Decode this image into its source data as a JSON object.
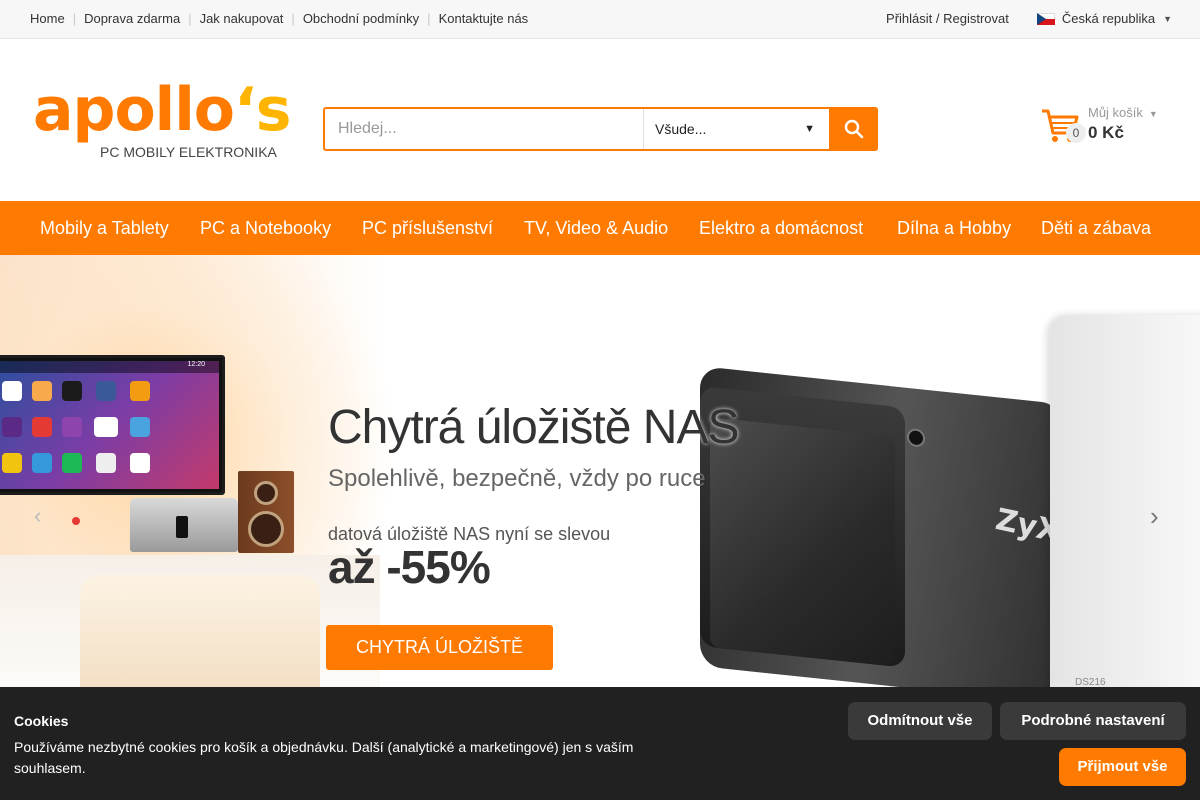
{
  "topbar": {
    "links": [
      "Home",
      "Doprava zdarma",
      "Jak nakupovat",
      "Obchodní podmínky",
      "Kontaktujte nás"
    ],
    "login": "Přihlásit / Registrovat",
    "country": "Česká republika"
  },
  "logo": {
    "main": "apollo",
    "apostrophe": "‘s",
    "sub": "PC MOBILY ELEKTRONIKA"
  },
  "search": {
    "placeholder": "Hledej...",
    "scope": "Všude..."
  },
  "cart": {
    "title": "Můj košík",
    "count": "0",
    "total": "0 Kč"
  },
  "nav": [
    "Mobily a Tablety",
    "PC a Notebooky",
    "PC příslušenství",
    "TV, Video & Audio",
    "Elektro a domácnost",
    "Dílna a Hobby",
    "Děti a zábava"
  ],
  "hero": {
    "title": "Chytrá úložiště NAS",
    "subtitle": "Spolehlivě, bezpečně, vždy po ruce",
    "promo_line": "datová úložiště NAS nyní se slevou",
    "discount": "až -55%",
    "cta": "CHYTRÁ ÚLOŽIŠTĚ",
    "device_brand": "ZyXEL",
    "device_label": "DS216",
    "tv_clock": "12:20"
  },
  "cookies": {
    "title": "Cookies",
    "text": "Používáme nezbytné cookies pro košík a objednávku. Další (analytické a marketingové) jen s vaším souhlasem.",
    "reject": "Odmítnout vše",
    "settings": "Podrobné nastavení",
    "accept": "Přijmout vše"
  },
  "colors": {
    "accent": "#ff7a00",
    "logo_apostrophe": "#ffb400",
    "cookie_bg": "#212121"
  }
}
